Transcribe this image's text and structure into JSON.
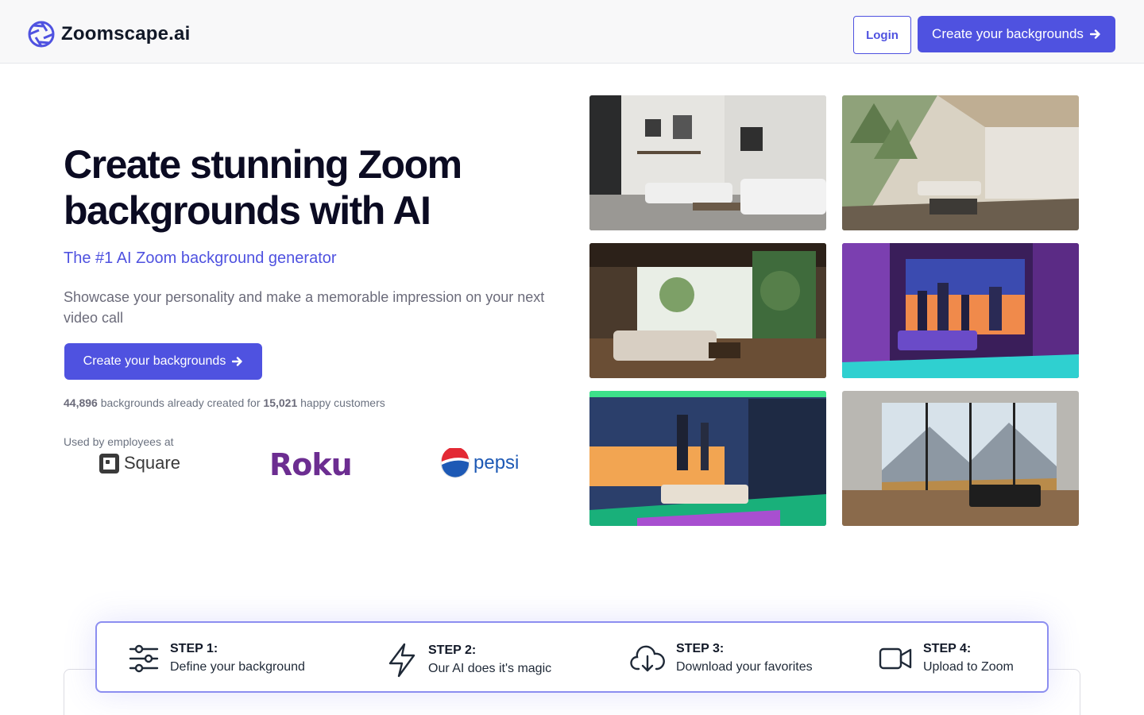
{
  "brand": {
    "name": "Zoomscape.ai",
    "accent": "#4f52e0"
  },
  "header": {
    "login_label": "Login",
    "cta_label": "Create your backgrounds"
  },
  "hero": {
    "title": "Create stunning Zoom backgrounds with AI",
    "subtitle": "The #1 AI Zoom background generator",
    "description": "Showcase your personality and make a memorable impression on your next video call",
    "cta_label": "Create your backgrounds",
    "stats": {
      "backgrounds_count": "44,896",
      "backgrounds_text": "backgrounds already created for",
      "customers_count": "15,021",
      "customers_text": "happy customers"
    },
    "used_by_label": "Used by employees at",
    "logos": {
      "square": "Square",
      "roku": "Roku",
      "pepsi": "pepsi"
    }
  },
  "gallery": [
    {
      "name": "modern-living-room-image"
    },
    {
      "name": "forest-cabin-living-room-image"
    },
    {
      "name": "tropical-lounge-image"
    },
    {
      "name": "neon-city-bedroom-image"
    },
    {
      "name": "neon-sunset-bedroom-image"
    },
    {
      "name": "mountain-view-room-image"
    }
  ],
  "steps": [
    {
      "label": "STEP 1:",
      "text": "Define your background",
      "icon": "sliders-icon"
    },
    {
      "label": "STEP 2:",
      "text": "Our AI does it's magic",
      "icon": "lightning-icon"
    },
    {
      "label": "STEP 3:",
      "text": "Download your favorites",
      "icon": "cloud-download-icon"
    },
    {
      "label": "STEP 4:",
      "text": "Upload to Zoom",
      "icon": "video-camera-icon"
    }
  ]
}
